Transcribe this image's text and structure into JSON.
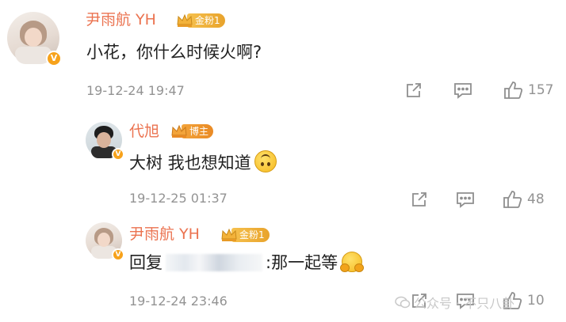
{
  "comments": [
    {
      "user": "尹雨航 YH",
      "badge": "金粉1",
      "text": "小花，你什么时候火啊?",
      "time": "19-12-24 19:47",
      "likes": "157"
    },
    {
      "user": "代旭",
      "badge": "博主",
      "text": "大树 我也想知道",
      "time": "19-12-25 01:37",
      "likes": "48"
    },
    {
      "user": "尹雨航 YH",
      "badge": "金粉1",
      "reply_prefix": "回复",
      "text": ":那一起等",
      "time": "19-12-24 23:46",
      "likes": "10"
    }
  ],
  "watermark": "公众号 · 不只八卦",
  "icons": {
    "verified": "verified-badge-icon",
    "crown": "crown-icon",
    "share": "share-icon",
    "comment": "comment-icon",
    "like": "like-icon"
  },
  "colors": {
    "username": "#eb7350",
    "meta": "#939393",
    "badge_gold": "#f0b23a",
    "verified": "#f7a21b"
  }
}
